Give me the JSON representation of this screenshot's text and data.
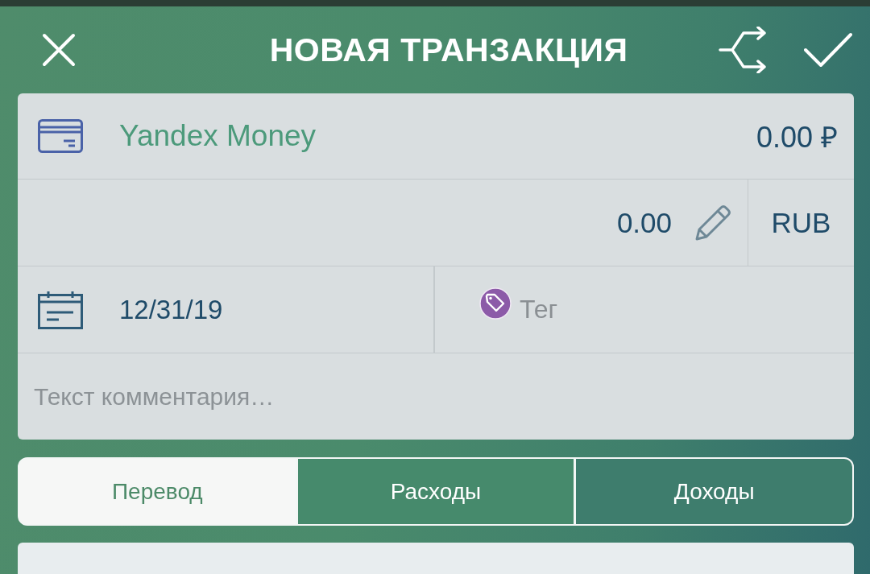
{
  "header": {
    "title": "НОВАЯ ТРАНЗАКЦИЯ"
  },
  "account": {
    "name": "Yandex Money",
    "balance": "0.00 ₽"
  },
  "amount": {
    "value": "0.00",
    "currency": "RUB"
  },
  "date": {
    "value": "12/31/19"
  },
  "tag": {
    "label": "Тег"
  },
  "comment": {
    "placeholder": "Текст комментария…"
  },
  "type_tabs": [
    {
      "label": "Перевод",
      "selected": true
    },
    {
      "label": "Расходы",
      "selected": false
    },
    {
      "label": "Доходы",
      "selected": false
    }
  ]
}
